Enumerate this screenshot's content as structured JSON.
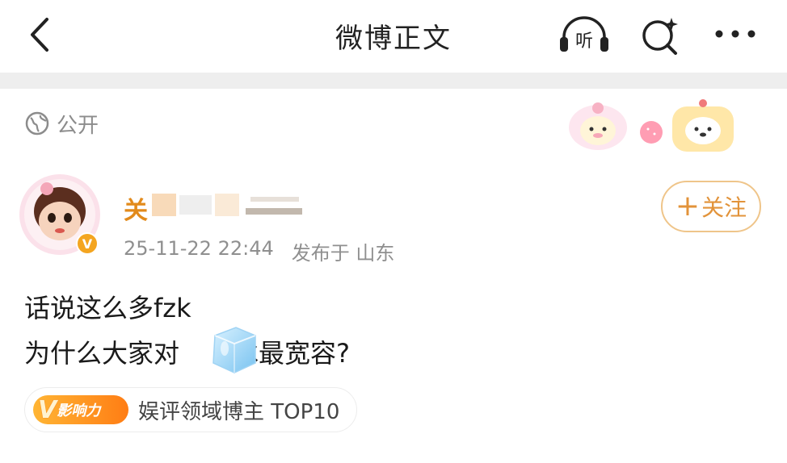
{
  "header": {
    "title": "微博正文",
    "back_icon": "chevron-left-icon",
    "listen_label": "听",
    "search_icon": "search-sparkle-icon",
    "more_icon": "more-horizontal-icon"
  },
  "post": {
    "visibility_label": "公开",
    "author_name": "关",
    "timestamp": "25-11-22 22:44",
    "location": "发布于 山东",
    "follow_label": "关注",
    "text_line1": "话说这么多fzk",
    "text_line2_before": "为什么大家对",
    "text_line2_after": "冰最宽容?",
    "badge_pill_label": "影响力",
    "badge_pill_letter": "V",
    "badge_text": "娱评领域博主 TOP10"
  },
  "colors": {
    "accent_orange": "#e2933a",
    "name_orange": "#e28a1b",
    "muted_gray": "#8f8f8f"
  }
}
